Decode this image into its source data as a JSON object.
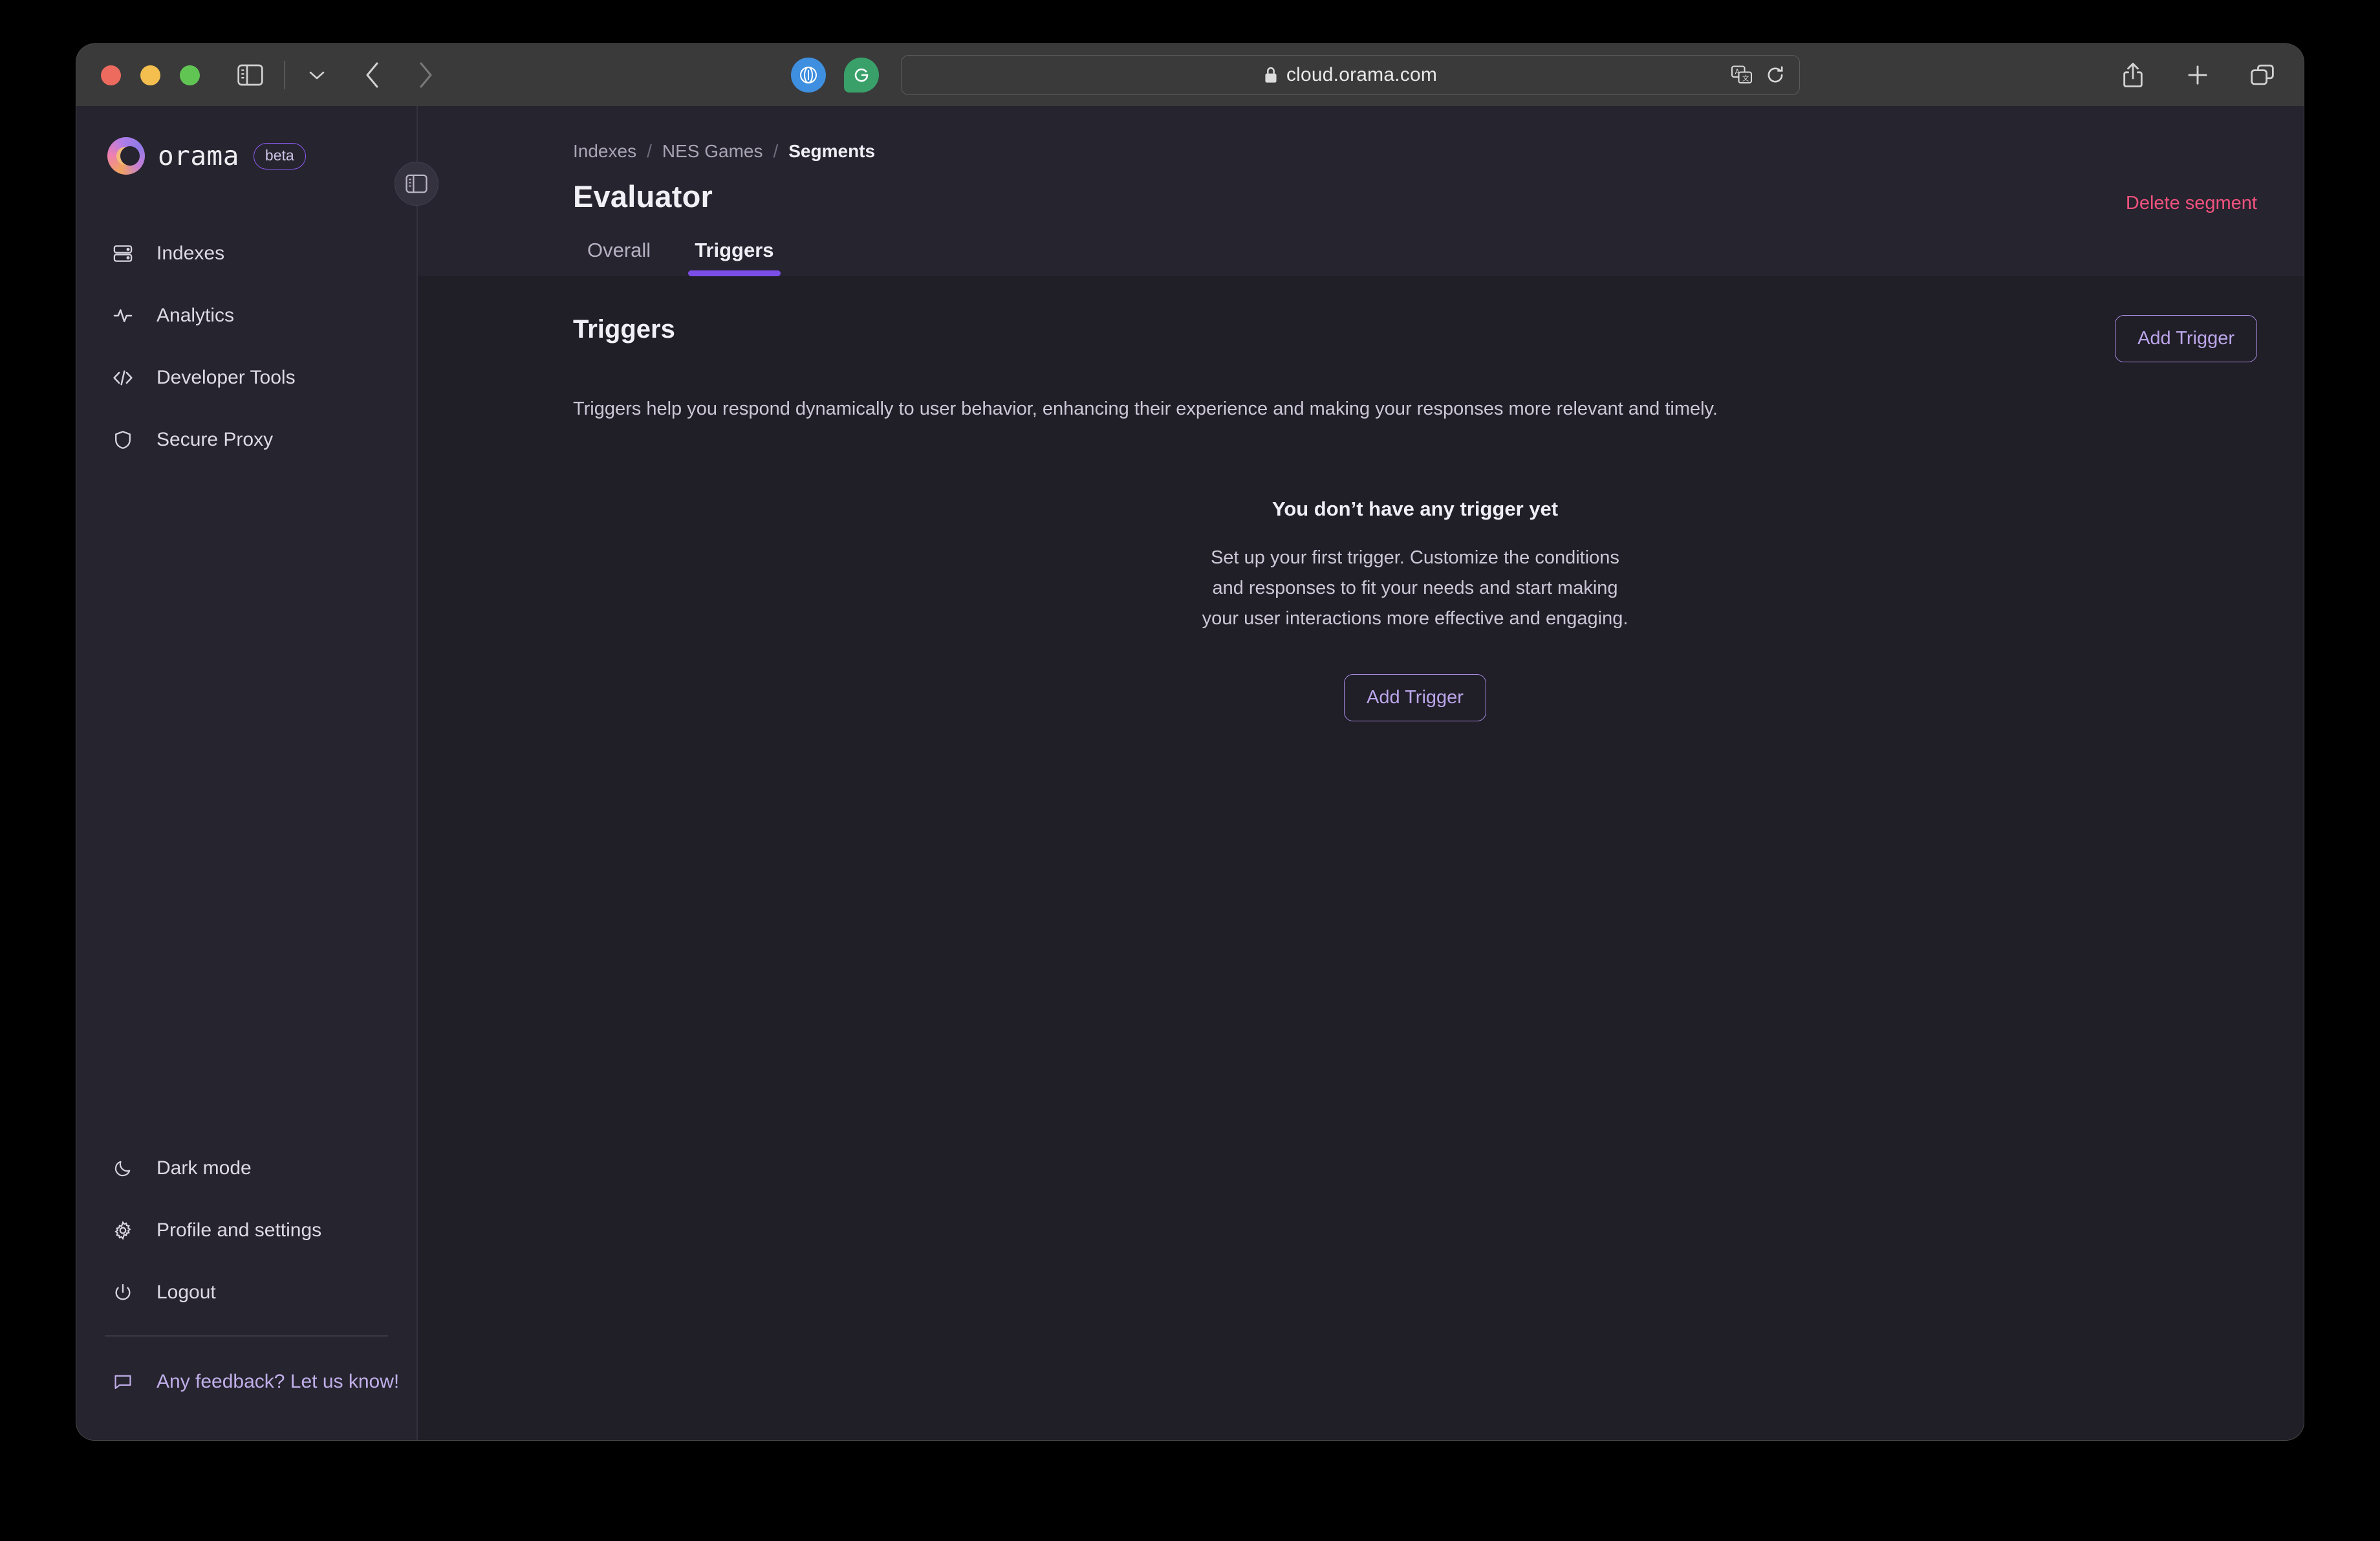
{
  "browser": {
    "url": "cloud.orama.com",
    "lock_icon": "lock-icon",
    "translate_icon": "translate-icon",
    "reload_icon": "reload-icon",
    "share_icon": "share-icon",
    "new_tab_icon": "plus-icon",
    "tab_overview_icon": "tab-overview-icon",
    "sidebar_icon": "sidebar-toggle-icon",
    "chevron_icon": "chevron-down-icon",
    "back_icon": "chevron-left-icon",
    "forward_icon": "chevron-right-icon",
    "extensions": [
      {
        "name": "1password-icon",
        "color": "#3f8fe0"
      },
      {
        "name": "grammarly-icon",
        "color": "#39a06a"
      }
    ]
  },
  "sidebar": {
    "logo_text": "orama",
    "badge": "beta",
    "collapse_icon": "sidebar-collapse-icon",
    "items": [
      {
        "label": "Indexes",
        "icon": "server-icon"
      },
      {
        "label": "Analytics",
        "icon": "activity-icon"
      },
      {
        "label": "Developer Tools",
        "icon": "code-icon"
      },
      {
        "label": "Secure Proxy",
        "icon": "shield-icon"
      }
    ],
    "bottom_items": [
      {
        "label": "Dark mode",
        "icon": "moon-icon"
      },
      {
        "label": "Profile and settings",
        "icon": "gear-icon"
      },
      {
        "label": "Logout",
        "icon": "power-icon"
      }
    ],
    "feedback": {
      "label": "Any feedback? Let us know!",
      "icon": "message-icon"
    }
  },
  "header": {
    "breadcrumb": [
      {
        "label": "Indexes",
        "current": false
      },
      {
        "label": "NES Games",
        "current": false
      },
      {
        "label": "Segments",
        "current": true
      }
    ],
    "separator": "/",
    "title": "Evaluator",
    "delete_label": "Delete segment",
    "tabs": [
      {
        "label": "Overall",
        "active": false
      },
      {
        "label": "Triggers",
        "active": true
      }
    ]
  },
  "content": {
    "section_title": "Triggers",
    "add_button": "Add Trigger",
    "description": "Triggers help you respond dynamically to user behavior, enhancing their experience and making your responses more relevant and timely.",
    "empty_state": {
      "title": "You don’t have any trigger yet",
      "text": "Set up your first trigger. Customize the conditions and responses to fit your needs and start making your user interactions more effective and engaging.",
      "button": "Add Trigger"
    }
  },
  "colors": {
    "accent_purple": "#7c4ee8",
    "button_purple": "#bba6ea",
    "danger_pink": "#f2527f",
    "sidebar_bg": "#26242e",
    "content_bg": "#201e27"
  }
}
